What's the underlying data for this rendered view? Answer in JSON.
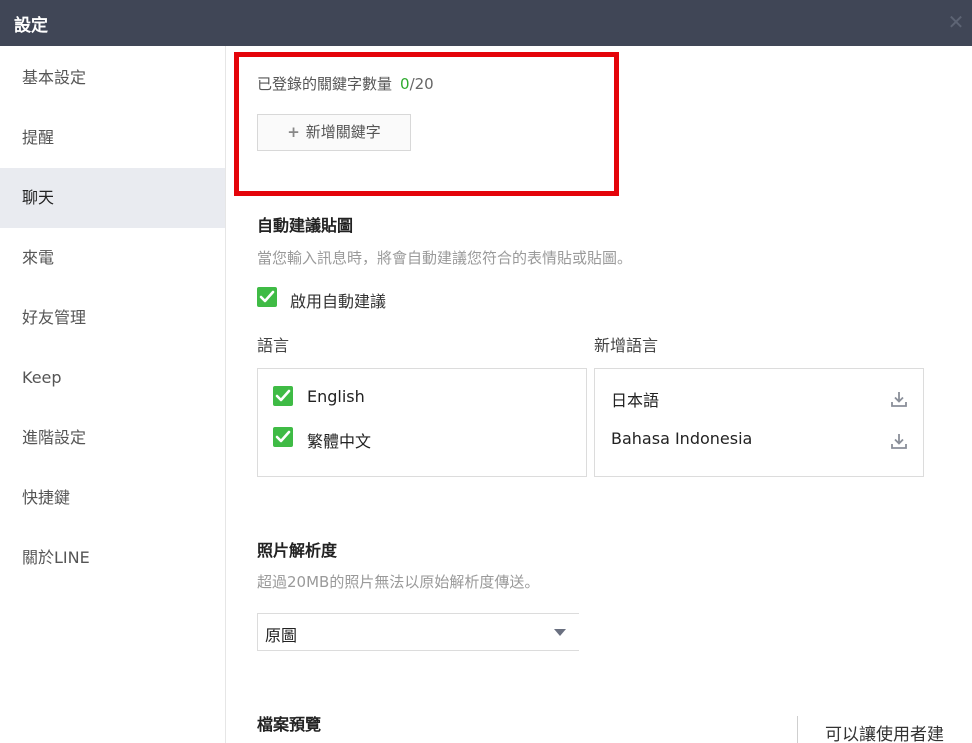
{
  "window": {
    "title": "設定",
    "close_glyph": "✕"
  },
  "sidebar": {
    "items": [
      {
        "label": "基本設定",
        "active": false
      },
      {
        "label": "提醒",
        "active": false
      },
      {
        "label": "聊天",
        "active": true
      },
      {
        "label": "來電",
        "active": false
      },
      {
        "label": "好友管理",
        "active": false
      },
      {
        "label": "Keep",
        "active": false
      },
      {
        "label": "進階設定",
        "active": false
      },
      {
        "label": "快捷鍵",
        "active": false
      },
      {
        "label": "關於LINE",
        "active": false
      }
    ]
  },
  "keywords": {
    "count_label": "已登錄的關鍵字數量",
    "count_current": "0",
    "count_sep": "/",
    "count_max": "20",
    "add_button_label": "新增關鍵字",
    "add_icon": "+"
  },
  "sticker_suggest": {
    "title": "自動建議貼圖",
    "description": "當您輸入訊息時，將會自動建議您符合的表情貼或貼圖。",
    "enable_label": "啟用自動建議",
    "enabled": true,
    "languages_header": "語言",
    "add_languages_header": "新增語言",
    "languages": [
      {
        "name": "English",
        "checked": true
      },
      {
        "name": "繁體中文",
        "checked": true
      }
    ],
    "available_languages": [
      {
        "name": "日本語",
        "icon": "download-icon"
      },
      {
        "name": "Bahasa Indonesia",
        "icon": "download-icon"
      }
    ]
  },
  "photo_resolution": {
    "title": "照片解析度",
    "description": "超過20MB的照片無法以原始解析度傳送。",
    "selected": "原圖"
  },
  "file_preview": {
    "title": "檔案預覽"
  },
  "background_fragment": "可以讓使用者建"
}
